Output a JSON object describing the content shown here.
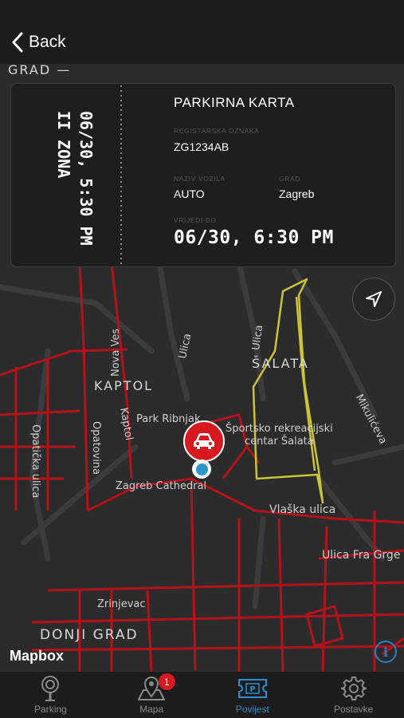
{
  "header": {
    "back_label": "Back"
  },
  "ticket": {
    "stub_time": "06/30, 5:30 PM",
    "stub_zone": "II ZONA",
    "title": "PARKIRNA KARTA",
    "plate_label": "REGISTARSKA OZNAKA",
    "plate_value": "ZG1234AB",
    "vehicle_label": "NAZIV VOZILA",
    "vehicle_value": "AUTO",
    "city_label": "GRAD",
    "city_value": "Zagreb",
    "valid_label": "VRIJEDI DO",
    "valid_value": "06/30, 6:30 PM"
  },
  "map": {
    "labels": {
      "grad_top": "GRAD —",
      "nova_ves": "Nova Ves",
      "ulica1": "Ulica",
      "ulica2": "Ulica",
      "opaticka": "Opatička ulica",
      "kaptol_area": "KAPTOL",
      "kaptol_street": "Kaptol",
      "opatovina": "Opatovina",
      "park_ribnjak": "Park Ribnjak",
      "salata": "ŠALATA",
      "sports_center": "Športsko rekreacijski\ncentar Šalata",
      "mikuliceva": "Mikulićeva",
      "cathedral": "Zagreb Cathedral",
      "vlaska": "Vlaška ulica",
      "fra_grge": "Ulica Fra Grge I",
      "zrinjevac": "Zrinjevac",
      "donji_grad": "DONJI GRAD"
    },
    "attribution": "Mapbox",
    "info_icon": "info-icon"
  },
  "tabs": [
    {
      "label": "Parking",
      "icon": "parking-meter-icon",
      "active": false
    },
    {
      "label": "Mapa",
      "icon": "map-pin-icon",
      "active": false,
      "badge": "1"
    },
    {
      "label": "Povijest",
      "icon": "ticket-icon",
      "active": true
    },
    {
      "label": "Postavke",
      "icon": "gear-icon",
      "active": false
    }
  ],
  "colors": {
    "road_red": "#b3121b",
    "zone_yellow": "#c9c43a",
    "accent_blue": "#2a8fcf",
    "pin_red": "#d61a1f"
  }
}
